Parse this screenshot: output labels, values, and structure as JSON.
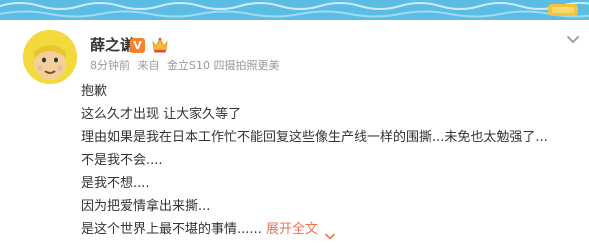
{
  "user": {
    "name": "薛之谦",
    "vip_badge": "V"
  },
  "meta": {
    "time": "8分钟前",
    "source_prefix": "来自",
    "device": "金立S10 四摄拍照更美"
  },
  "post": {
    "lines": [
      "抱歉",
      "这么久才出现 让大家久等了",
      "理由如果是我在日本工作忙不能回复这些像生产线一样的围撕...未免也太勉强了...",
      "不是我不会....",
      "是我不想....",
      "因为把爱情拿出来撕...",
      "是这个世界上最不堪的事情......"
    ],
    "expand_label": "展开全文"
  },
  "colors": {
    "accent_link": "#eb7350",
    "meta_gray": "#999999",
    "vip_orange": "#f7822a"
  }
}
